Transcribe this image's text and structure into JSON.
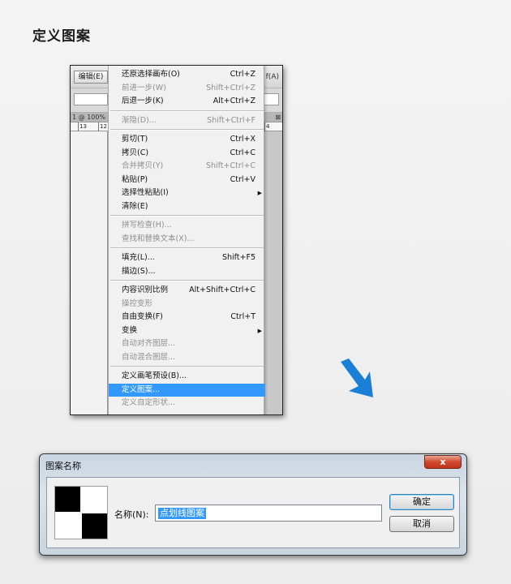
{
  "page": {
    "title": "定义图案"
  },
  "photoshop": {
    "menubar": {
      "edit_label": "编辑(E)",
      "help_stub": "f(A)"
    },
    "doc_tab": {
      "label": "1 @ 100%",
      "close": "⊠"
    },
    "ruler": {
      "nums": [
        "13",
        "12",
        "4"
      ]
    }
  },
  "edit_menu": {
    "items": [
      {
        "label": "还原选择画布(O)",
        "shortcut": "Ctrl+Z",
        "disabled": false
      },
      {
        "label": "前进一步(W)",
        "shortcut": "Shift+Ctrl+Z",
        "disabled": true
      },
      {
        "label": "后退一步(K)",
        "shortcut": "Alt+Ctrl+Z",
        "disabled": false
      },
      {
        "label": "渐隐(D)...",
        "shortcut": "Shift+Ctrl+F",
        "disabled": true
      },
      {
        "label": "剪切(T)",
        "shortcut": "Ctrl+X",
        "disabled": false
      },
      {
        "label": "拷贝(C)",
        "shortcut": "Ctrl+C",
        "disabled": false
      },
      {
        "label": "合并拷贝(Y)",
        "shortcut": "Shift+Ctrl+C",
        "disabled": true
      },
      {
        "label": "粘贴(P)",
        "shortcut": "Ctrl+V",
        "disabled": false
      },
      {
        "label": "选择性粘贴(I)",
        "shortcut": "",
        "disabled": false,
        "submenu": true
      },
      {
        "label": "清除(E)",
        "shortcut": "",
        "disabled": false
      },
      {
        "label": "拼写检查(H)...",
        "shortcut": "",
        "disabled": true
      },
      {
        "label": "查找和替换文本(X)...",
        "shortcut": "",
        "disabled": true
      },
      {
        "label": "填充(L)...",
        "shortcut": "Shift+F5",
        "disabled": false
      },
      {
        "label": "描边(S)...",
        "shortcut": "",
        "disabled": false
      },
      {
        "label": "内容识别比例",
        "shortcut": "Alt+Shift+Ctrl+C",
        "disabled": false
      },
      {
        "label": "操控变形",
        "shortcut": "",
        "disabled": true
      },
      {
        "label": "自由变换(F)",
        "shortcut": "Ctrl+T",
        "disabled": false
      },
      {
        "label": "变换",
        "shortcut": "",
        "disabled": false,
        "submenu": true
      },
      {
        "label": "自动对齐图层...",
        "shortcut": "",
        "disabled": true
      },
      {
        "label": "自动混合图层...",
        "shortcut": "",
        "disabled": true
      },
      {
        "label": "定义画笔预设(B)...",
        "shortcut": "",
        "disabled": false
      },
      {
        "label": "定义图案...",
        "shortcut": "",
        "disabled": false,
        "highlighted": true
      },
      {
        "label": "定义自定形状...",
        "shortcut": "",
        "disabled": true
      }
    ],
    "submenu_arrow": "▶"
  },
  "dialog": {
    "title": "图案名称",
    "close_label": "x",
    "name_label": "名称(N):",
    "name_value": "点划线图案",
    "ok_label": "确定",
    "cancel_label": "取消"
  },
  "colors": {
    "highlight": "#3399ff",
    "arrow": "#1a7fd6",
    "close_red": "#c94a30"
  },
  "icons": {
    "arrow": "diagonal-arrow-down-right-icon"
  }
}
